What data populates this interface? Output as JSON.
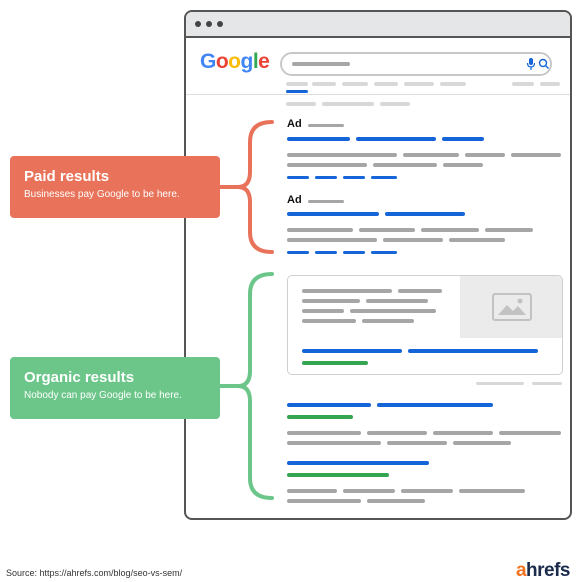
{
  "browser": {
    "search_engine_logo": [
      "G",
      "o",
      "o",
      "g",
      "l",
      "e"
    ],
    "search_icons": [
      "mic-icon",
      "search-icon"
    ],
    "ad_label_1": "Ad",
    "ad_label_2": "Ad"
  },
  "labels": {
    "paid": {
      "title": "Paid results",
      "subtitle": "Businesses pay Google to be here."
    },
    "organic": {
      "title": "Organic results",
      "subtitle": "Nobody can pay Google to be here."
    }
  },
  "footer": {
    "source": "Source:  https://ahrefs.com/blog/seo-vs-sem/",
    "brand_a": "a",
    "brand_rest": "hrefs"
  },
  "colors": {
    "paid": "#e8735a",
    "organic": "#6cc68a",
    "link": "#1565d8",
    "url": "#35a552",
    "brand_accent": "#f47321",
    "brand": "#1a2b4c"
  }
}
